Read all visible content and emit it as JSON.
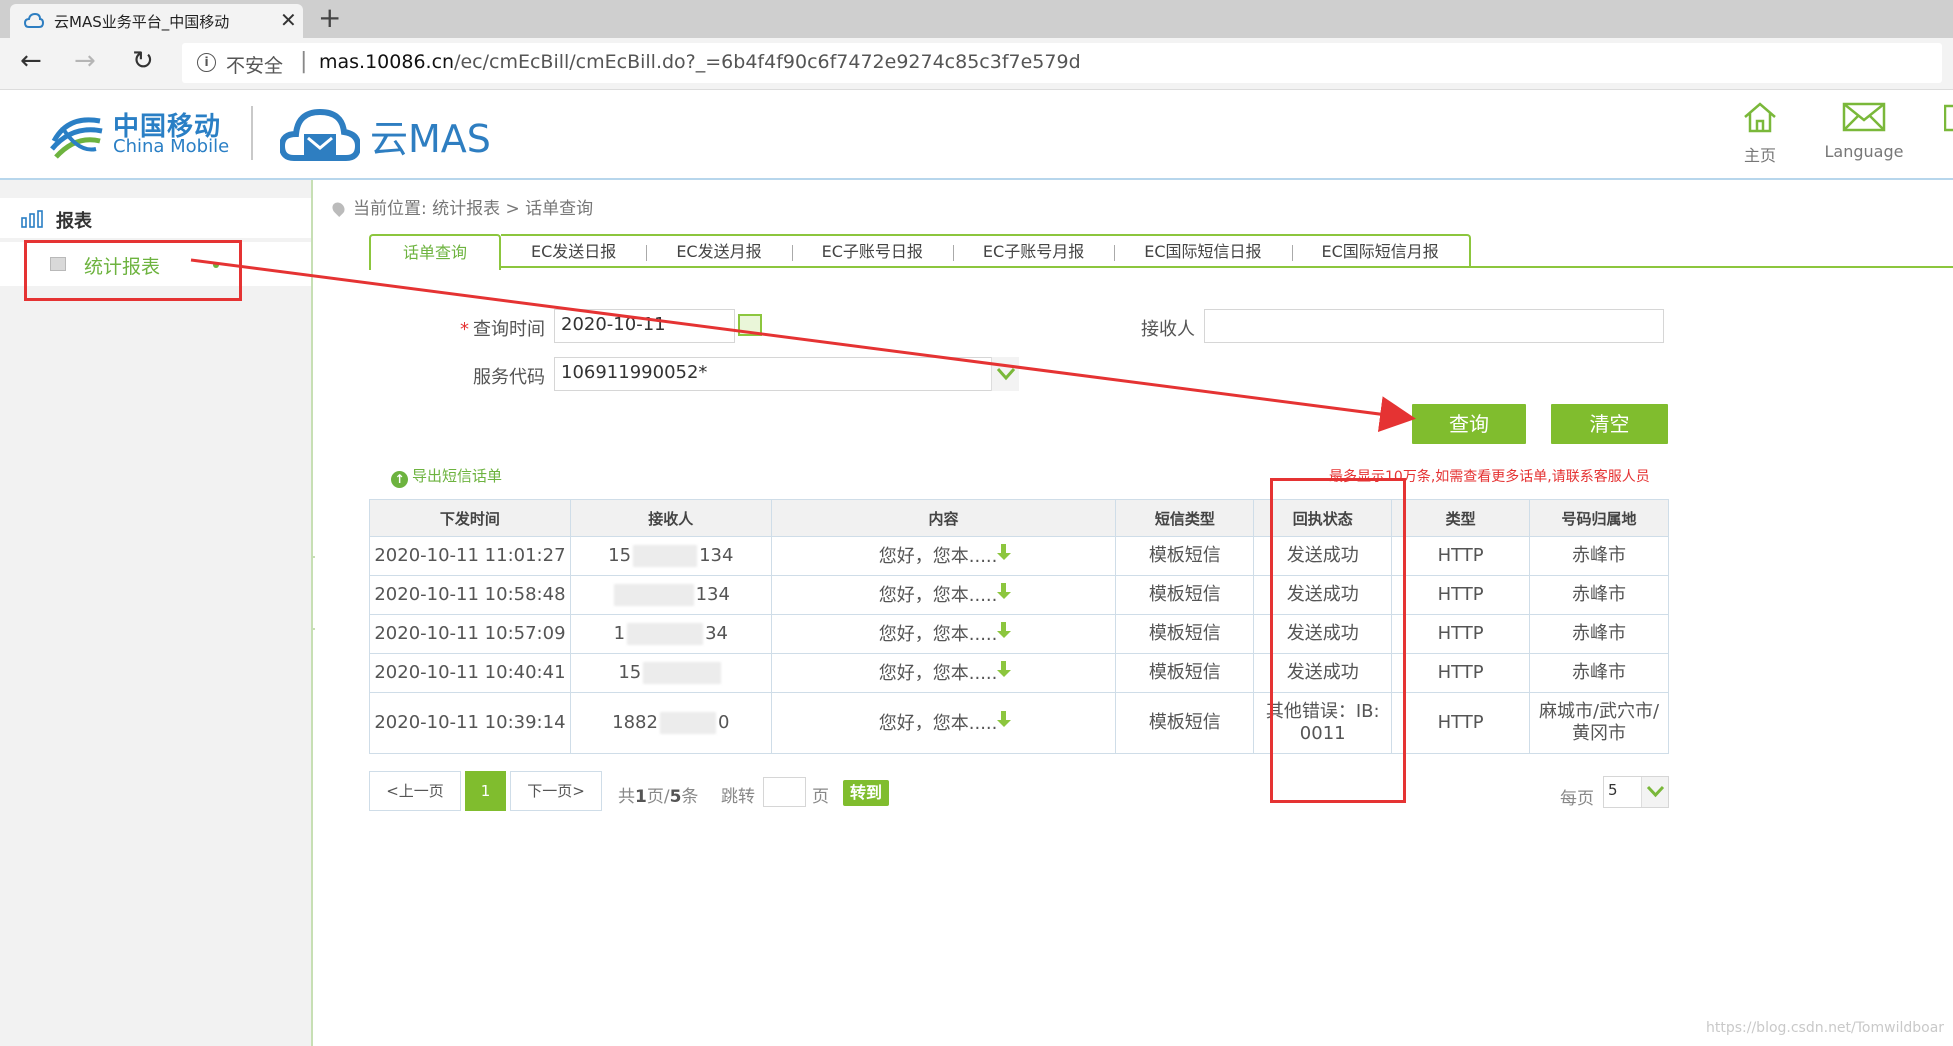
{
  "browser": {
    "tab_title": "云MAS业务平台_中国移动",
    "close_glyph": "✕",
    "new_tab_glyph": "+",
    "back_glyph": "←",
    "forward_glyph": "→",
    "reload_glyph": "↻",
    "info_glyph": "i",
    "insecure_label": "不安全",
    "separator": "|",
    "url_host": "mas.10086.cn",
    "url_path": "/ec/cmEcBill/cmEcBill.do?_=6b4f4f90c6f7472e9274c85c3f7e579d"
  },
  "header": {
    "brand_cn": "中国移动",
    "brand_en": "China Mobile",
    "product_name": "云MAS",
    "home_label": "主页",
    "language_label": "Language"
  },
  "sidebar": {
    "section_label": "报表",
    "item_label": "统计报表",
    "collapse_glyph": "‹"
  },
  "breadcrumb": "当前位置: 统计报表 > 话单查询",
  "tabs": {
    "active": "话单查询",
    "others": [
      "EC发送日报",
      "EC发送月报",
      "EC子账号日报",
      "EC子账号月报",
      "EC国际短信日报",
      "EC国际短信月报"
    ]
  },
  "form": {
    "required_mark": "*",
    "query_time_label": "查询时间",
    "query_time_value": "2020-10-11",
    "receiver_label": "接收人",
    "receiver_value": "",
    "service_code_label": "服务代码",
    "service_code_value": "106911990052*",
    "query_button": "查询",
    "clear_button": "清空"
  },
  "export": {
    "icon_glyph": "↑",
    "label": "导出短信话单"
  },
  "notice": "最多显示10万条,如需查看更多话单,请联系客服人员",
  "table": {
    "headers": [
      "下发时间",
      "接收人",
      "内容",
      "短信类型",
      "回执状态",
      "类型",
      "号码归属地"
    ],
    "rows": [
      {
        "time": "2020-10-11 11:01:27",
        "recv_pre": "15",
        "recv_post": "134",
        "content": "您好，您本.....",
        "sms_type": "模板短信",
        "status": "发送成功",
        "type": "HTTP",
        "location": "赤峰市"
      },
      {
        "time": "2020-10-11 10:58:48",
        "recv_pre": "",
        "recv_post": "134",
        "content": "您好，您本.....",
        "sms_type": "模板短信",
        "status": "发送成功",
        "type": "HTTP",
        "location": "赤峰市"
      },
      {
        "time": "2020-10-11 10:57:09",
        "recv_pre": "1",
        "recv_post": "34",
        "content": "您好，您本.....",
        "sms_type": "模板短信",
        "status": "发送成功",
        "type": "HTTP",
        "location": "赤峰市"
      },
      {
        "time": "2020-10-11 10:40:41",
        "recv_pre": "15",
        "recv_post": "",
        "content": "您好，您本.....",
        "sms_type": "模板短信",
        "status": "发送成功",
        "type": "HTTP",
        "location": "赤峰市"
      },
      {
        "time": "2020-10-11 10:39:14",
        "recv_pre": "1882",
        "recv_post": "0",
        "content": "您好，您本.....",
        "sms_type": "模板短信",
        "status": "其他错误：IB:0011",
        "type": "HTTP",
        "location": "麻城市/武穴市/黄冈市"
      }
    ]
  },
  "pagination": {
    "prev": "<上一页",
    "current": "1",
    "next": "下一页>",
    "summary_pre": "共",
    "total_pages": "1",
    "summary_mid": "页/",
    "total_records": "5",
    "summary_post": "条",
    "jump_label": "跳转",
    "page_unit": "页",
    "go_button": "转到",
    "per_page_label": "每页",
    "per_page_value": "5"
  },
  "watermark": "https://blog.csdn.net/Tomwildboar",
  "colors": {
    "accent_green": "#80bd2e",
    "brand_blue": "#2a7fc5",
    "annotation_red": "#e53333"
  }
}
